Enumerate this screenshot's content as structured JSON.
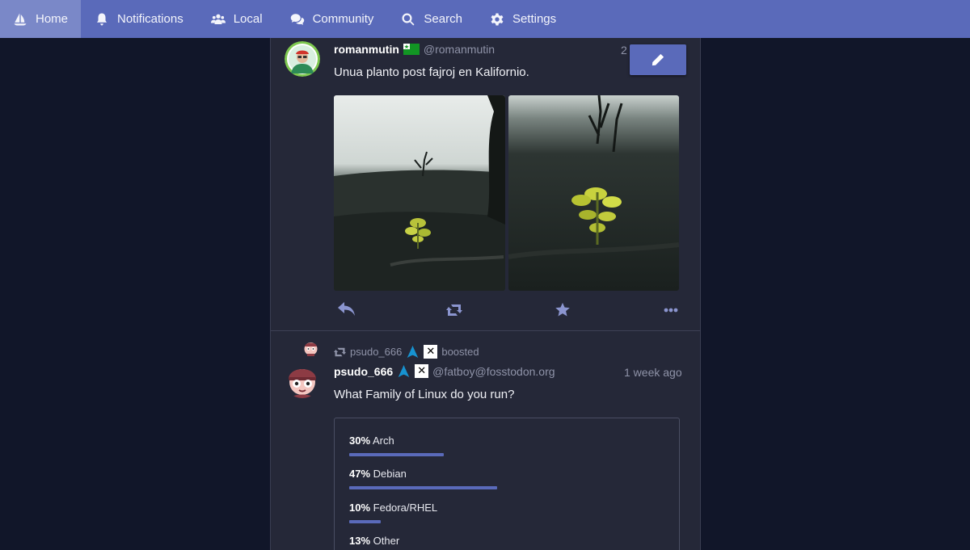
{
  "nav": {
    "items": [
      {
        "label": "Home",
        "icon": "sailboat-icon",
        "active": true
      },
      {
        "label": "Notifications",
        "icon": "bell-icon"
      },
      {
        "label": "Local",
        "icon": "users-icon"
      },
      {
        "label": "Community",
        "icon": "comments-icon"
      },
      {
        "label": "Search",
        "icon": "search-icon"
      },
      {
        "label": "Settings",
        "icon": "gear-icon"
      }
    ]
  },
  "colors": {
    "accent": "#5a6aba",
    "background": "#111629",
    "column": "#252838",
    "muted_text": "#8f93a8"
  },
  "status1": {
    "display_name": "romanmutin",
    "flag_icon": "esperanto-flag-icon",
    "handle": "@romanmutin",
    "time": "2",
    "content": "Unua planto post fajroj en Kalifornio.",
    "media": [
      "burnt-forest-seedling-photo-1",
      "burnt-forest-seedling-photo-2"
    ]
  },
  "status2": {
    "boosted_by": "psudo_666",
    "boosted_label": "boosted",
    "display_name": "psudo_666",
    "handle": "@fatboy@fosstodon.org",
    "time": "1 week ago",
    "content": "What Family of Linux do you run?",
    "poll": [
      {
        "percent": "30%",
        "label": "Arch",
        "value": 0.3
      },
      {
        "percent": "47%",
        "label": "Debian",
        "value": 0.47
      },
      {
        "percent": "10%",
        "label": "Fedora/RHEL",
        "value": 0.1
      },
      {
        "percent": "13%",
        "label": "Other",
        "value": 0.13
      }
    ]
  },
  "actions": [
    "reply-icon",
    "boost-icon",
    "favourite-icon",
    "more-icon"
  ],
  "edit_button_icon": "pencil-icon"
}
